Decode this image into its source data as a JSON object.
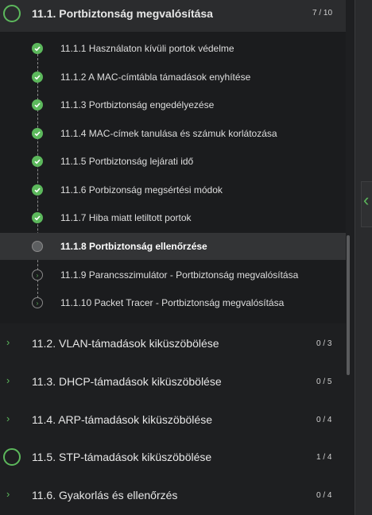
{
  "colors": {
    "accent": "#5cb85c",
    "background": "#1e1f21",
    "active_row": "#333436"
  },
  "open_section": {
    "title": "11.1. Portbiztonság megvalósítása",
    "count": "7 / 10",
    "progress": 0.7
  },
  "sub_items": [
    {
      "label": "11.1.1 Használaton kívüli portok védelme",
      "status": "completed"
    },
    {
      "label": "11.1.2 A MAC-címtábla támadások enyhítése",
      "status": "completed"
    },
    {
      "label": "11.1.3 Portbiztonság engedélyezése",
      "status": "completed"
    },
    {
      "label": "11.1.4 MAC-címek tanulása és számuk korlátozása",
      "status": "completed"
    },
    {
      "label": "11.1.5 Portbiztonság lejárati idő",
      "status": "completed"
    },
    {
      "label": "11.1.6 Porbizonság megsértési módok",
      "status": "completed"
    },
    {
      "label": "11.1.7 Hiba miatt letiltott portok",
      "status": "completed"
    },
    {
      "label": "11.1.8 Portbiztonság ellenőrzése",
      "status": "active"
    },
    {
      "label": "11.1.9 Parancsszimulátor - Portbiztonság megvalósítása",
      "status": "not-started"
    },
    {
      "label": "11.1.10 Packet Tracer - Portbiztonság megvalósítása",
      "status": "not-started"
    }
  ],
  "sections": [
    {
      "title": "11.2. VLAN-támadások kiküszöbölése",
      "count": "0 / 3",
      "icon": "chevron-right-icon"
    },
    {
      "title": "11.3. DHCP-támadások kiküszöbölése",
      "count": "0 / 5",
      "icon": "chevron-right-icon"
    },
    {
      "title": "11.4. ARP-támadások kiküszöbölése",
      "count": "0 / 4",
      "icon": "chevron-right-icon"
    },
    {
      "title": "11.5. STP-támadások kiküszöbölése",
      "count": "1 / 4",
      "icon": "progress-ring-icon",
      "progress": 0.25
    },
    {
      "title": "11.6. Gyakorlás és ellenőrzés",
      "count": "0 / 4",
      "icon": "chevron-right-icon"
    }
  ]
}
